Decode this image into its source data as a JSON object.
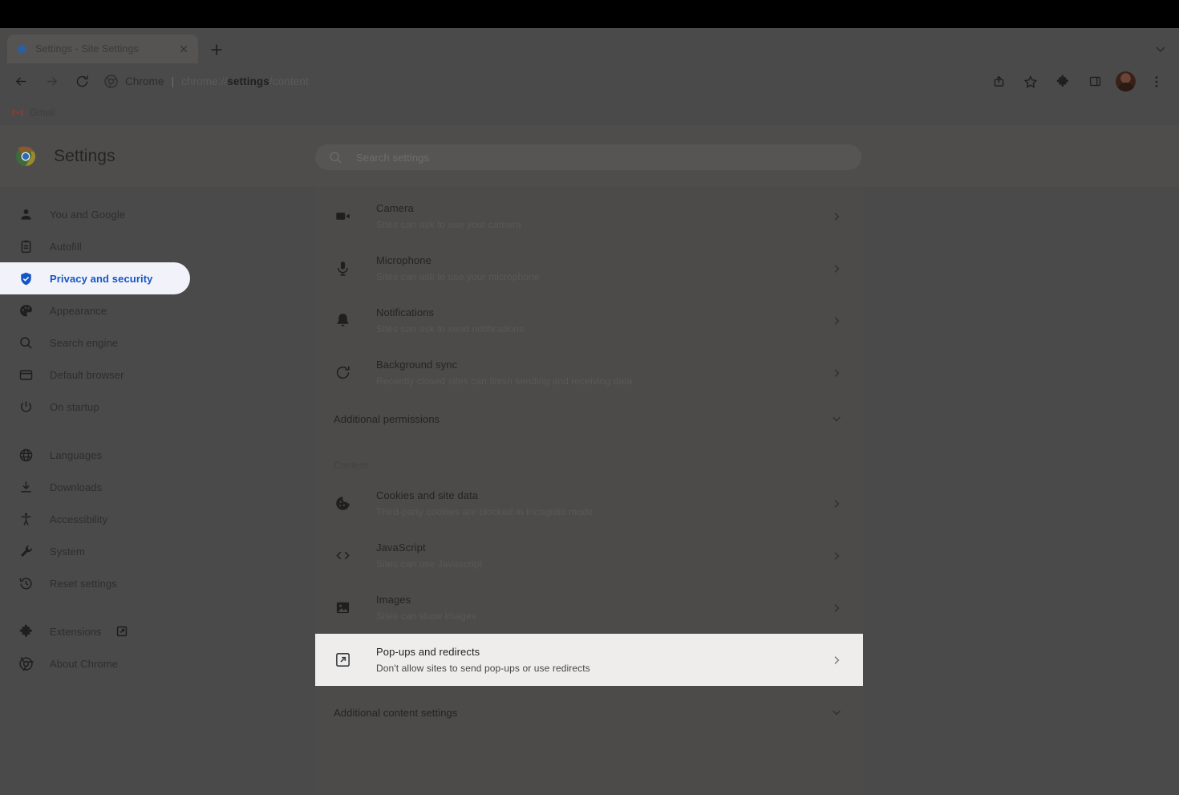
{
  "window": {
    "tab": {
      "title": "Settings - Site Settings",
      "favicon": "gear-icon"
    },
    "new_tab_label": "+",
    "omnibox": {
      "chip": "Chrome",
      "separator": "|",
      "url_prefix": "chrome://",
      "url_bold": "settings",
      "url_suffix": "/content"
    },
    "toolbar_icons": [
      "share-icon",
      "star-icon",
      "puzzle-extensions-icon",
      "side-panel-icon",
      "profile-avatar",
      "three-dot-menu-icon"
    ],
    "bookmarks": [
      {
        "label": "Gmail",
        "icon": "gmail-icon"
      }
    ]
  },
  "settings": {
    "title": "Settings",
    "search": {
      "placeholder": "Search settings",
      "value": ""
    },
    "sidebar": [
      {
        "label": "You and Google",
        "icon": "person-icon",
        "selected": false
      },
      {
        "label": "Autofill",
        "icon": "clipboard-icon",
        "selected": false
      },
      {
        "label": "Privacy and security",
        "icon": "shield-icon",
        "selected": true
      },
      {
        "label": "Appearance",
        "icon": "palette-icon",
        "selected": false
      },
      {
        "label": "Search engine",
        "icon": "search-icon",
        "selected": false
      },
      {
        "label": "Default browser",
        "icon": "browser-window-icon",
        "selected": false
      },
      {
        "label": "On startup",
        "icon": "power-icon",
        "selected": false
      }
    ],
    "sidebar_secondary": [
      {
        "label": "Languages",
        "icon": "globe-icon"
      },
      {
        "label": "Downloads",
        "icon": "download-icon"
      },
      {
        "label": "Accessibility",
        "icon": "accessibility-icon"
      },
      {
        "label": "System",
        "icon": "wrench-icon"
      },
      {
        "label": "Reset settings",
        "icon": "history-restore-icon"
      }
    ],
    "sidebar_tertiary": [
      {
        "label": "Extensions",
        "icon": "puzzle-icon",
        "external": true
      },
      {
        "label": "About Chrome",
        "icon": "chrome-logo-icon",
        "external": false
      }
    ]
  },
  "content": {
    "permissions": [
      {
        "title": "Camera",
        "sub": "Sites can ask to use your camera",
        "icon": "video-camera-icon"
      },
      {
        "title": "Microphone",
        "sub": "Sites can ask to use your microphone",
        "icon": "microphone-icon"
      },
      {
        "title": "Notifications",
        "sub": "Sites can ask to send notifications",
        "icon": "bell-icon"
      },
      {
        "title": "Background sync",
        "sub": "Recently closed sites can finish sending and receiving data",
        "icon": "sync-icon"
      }
    ],
    "additional_permissions_label": "Additional permissions",
    "content_section_label": "Content",
    "content_items": [
      {
        "title": "Cookies and site data",
        "sub": "Third-party cookies are blocked in Incognito mode",
        "icon": "cookie-icon",
        "highlighted": false
      },
      {
        "title": "JavaScript",
        "sub": "Sites can use Javascript",
        "icon": "code-brackets-icon",
        "highlighted": false
      },
      {
        "title": "Images",
        "sub": "Sites can show images",
        "icon": "image-icon",
        "highlighted": false
      },
      {
        "title": "Pop-ups and redirects",
        "sub": "Don't allow sites to send pop-ups or use redirects",
        "icon": "external-link-icon",
        "highlighted": true
      }
    ],
    "additional_content_settings_label": "Additional content settings"
  },
  "colors": {
    "accent_blue": "#1456c4",
    "selected_pill_bg": "#f2f3fa",
    "highlight_row_bg": "#eeedeb",
    "dimmed_page_bg": "#4a4a4a",
    "dimmed_card_bg": "#4d4b4a"
  }
}
